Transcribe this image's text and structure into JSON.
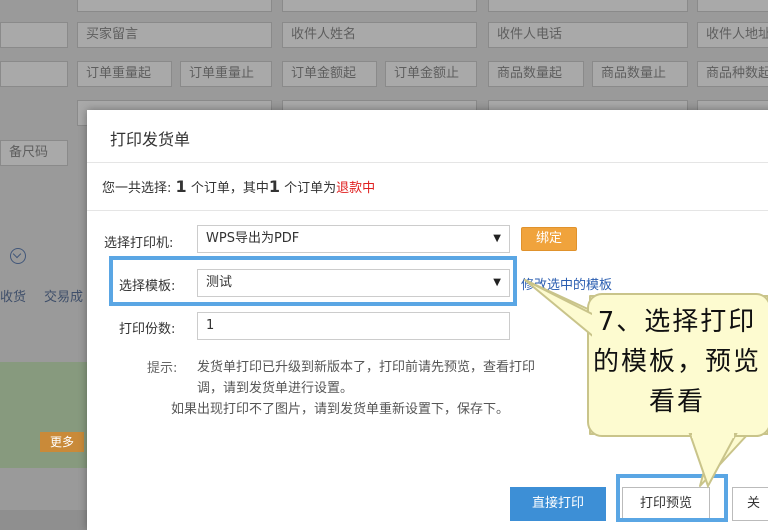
{
  "background": {
    "fields": [
      "买家留言",
      "收件人姓名",
      "收件人电话",
      "收件人地址",
      "订单重量起",
      "订单重量止",
      "订单金额起",
      "订单金额止",
      "商品数量起",
      "商品数量止",
      "商品种数起",
      "备尺码"
    ],
    "tabs": [
      "收货",
      "交易成"
    ],
    "more_button": "更多"
  },
  "dialog": {
    "title": "打印发货单",
    "summary": {
      "prefix": "您一共选择:",
      "count": "1",
      "mid": "个订单，其中",
      "refund_count": "1",
      "suffix": "个订单为",
      "status": "退款中"
    },
    "printer": {
      "label": "选择打印机:",
      "value": "WPS导出为PDF",
      "bind_button": "绑定"
    },
    "template": {
      "label": "选择模板:",
      "value": "测试",
      "edit_link": "修改选中的模板"
    },
    "copies": {
      "label": "打印份数:",
      "value": "1"
    },
    "tip": {
      "label": "提示:",
      "line1": "发货单打印已升级到新版本了，打印前请先预览，查看打印",
      "line2": "调，请到发货单进行设置。",
      "line3": "如果出现打印不了图片，请到发货单重新设置下，保存下。"
    },
    "buttons": {
      "direct_print": "直接打印",
      "preview": "打印预览",
      "close": "关"
    }
  },
  "annotation": {
    "callout_text": "7、选择打印的模板，预览看看",
    "callout_color": "#fdfbd0",
    "highlight_color": "#5aa6e4"
  }
}
